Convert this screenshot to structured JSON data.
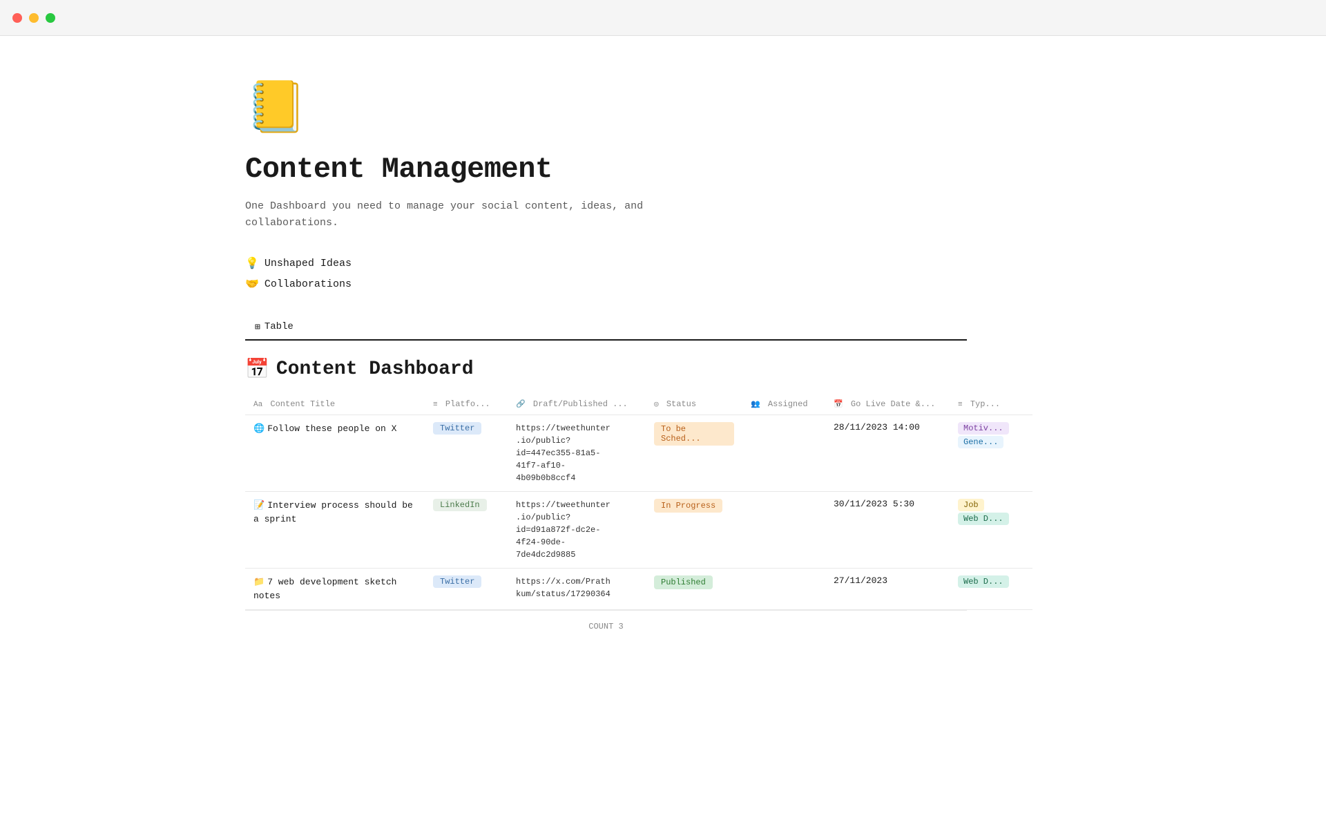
{
  "titlebar": {
    "tl_red": "close",
    "tl_yellow": "minimize",
    "tl_green": "maximize"
  },
  "page": {
    "icon": "📒",
    "title": "Content Management",
    "description": "One Dashboard you need to manage your social content, ideas, and\ncollaborations.",
    "links": [
      {
        "emoji": "💡",
        "label": "Unshaped Ideas"
      },
      {
        "emoji": "🤝",
        "label": "Collaborations"
      }
    ]
  },
  "tabs": [
    {
      "icon": "⊞",
      "label": "Table",
      "active": true
    }
  ],
  "section": {
    "icon": "📅",
    "title": "Content Dashboard"
  },
  "table": {
    "columns": [
      {
        "icon": "Aa",
        "label": "Content Title"
      },
      {
        "icon": "≡",
        "label": "Platfo..."
      },
      {
        "icon": "🔗",
        "label": "Draft/Published ..."
      },
      {
        "icon": "◎",
        "label": "Status"
      },
      {
        "icon": "👥",
        "label": "Assigned"
      },
      {
        "icon": "📅",
        "label": "Go Live Date &..."
      },
      {
        "icon": "≡",
        "label": "Typ..."
      }
    ],
    "rows": [
      {
        "icon": "🌐",
        "title": "Follow these people on X",
        "platform": "Twitter",
        "platform_class": "badge-twitter",
        "url": "https://tweethunter\n.io/public?\nid=447ec355-81a5-\n41f7-af10-\n4b09b0b8ccf4",
        "status": "To be Sched...",
        "status_class": "status-scheduled",
        "assigned": "",
        "golive": "28/11/2023 14:00",
        "type1": "Motiv...",
        "type1_class": "type-motiv",
        "type2": "Gene...",
        "type2_class": "type-gene"
      },
      {
        "icon": "📝",
        "title": "Interview process should be a sprint",
        "platform": "LinkedIn",
        "platform_class": "badge-linkedin",
        "url": "https://tweethunter\n.io/public?\nid=d91a872f-dc2e-\n4f24-90de-\n7de4dc2d9885",
        "status": "In Progress",
        "status_class": "status-inprogress",
        "assigned": "",
        "golive": "30/11/2023 5:30",
        "type1": "Job",
        "type1_class": "type-job",
        "type2": "Web D...",
        "type2_class": "type-web"
      },
      {
        "icon": "📁",
        "title": "7 web development sketch notes",
        "platform": "Twitter",
        "platform_class": "badge-twitter",
        "url": "https://x.com/Prath\nkum/status/17290364",
        "status": "Published",
        "status_class": "status-published",
        "assigned": "",
        "golive": "27/11/2023",
        "type1": "Web D...",
        "type1_class": "type-web",
        "type2": "",
        "type2_class": ""
      }
    ],
    "count_label": "COUNT",
    "count_value": "3"
  }
}
